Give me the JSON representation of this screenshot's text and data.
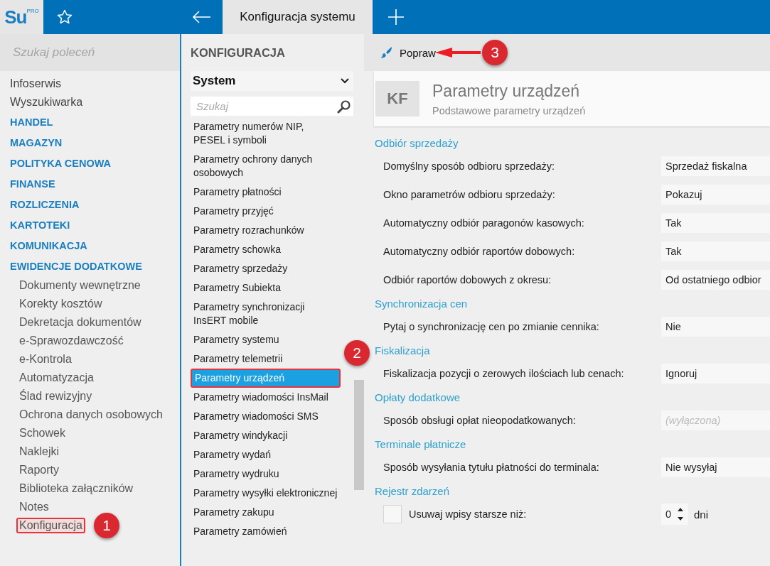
{
  "topbar": {
    "logo": {
      "text": "Su",
      "sup": "PRO"
    },
    "tab": "Konfiguracja systemu"
  },
  "sidebar": {
    "search": {
      "placeholder": "Szukaj poleceń"
    },
    "items": [
      {
        "label": "Infoserwis",
        "kind": "link",
        "highlighted": false
      },
      {
        "label": "Wyszukiwarka",
        "kind": "link",
        "highlighted": false
      },
      {
        "label": "HANDEL",
        "kind": "section",
        "highlighted": false
      },
      {
        "label": "MAGAZYN",
        "kind": "section",
        "highlighted": false
      },
      {
        "label": "POLITYKA CENOWA",
        "kind": "section",
        "highlighted": false
      },
      {
        "label": "FINANSE",
        "kind": "section",
        "highlighted": false
      },
      {
        "label": "ROZLICZENIA",
        "kind": "section",
        "highlighted": false
      },
      {
        "label": "KARTOTEKI",
        "kind": "section",
        "highlighted": false
      },
      {
        "label": "KOMUNIKACJA",
        "kind": "section",
        "highlighted": false
      },
      {
        "label": "EWIDENCJE DODATKOWE",
        "kind": "section",
        "highlighted": false
      },
      {
        "label": "Dokumenty wewnętrzne",
        "kind": "subitem",
        "highlighted": false
      },
      {
        "label": "Korekty kosztów",
        "kind": "subitem",
        "highlighted": false
      },
      {
        "label": "Dekretacja dokumentów",
        "kind": "subitem",
        "highlighted": false
      },
      {
        "label": "e-Sprawozdawczość",
        "kind": "subitem",
        "highlighted": false
      },
      {
        "label": "e-Kontrola",
        "kind": "subitem",
        "highlighted": false
      },
      {
        "label": "Automatyzacja",
        "kind": "subitem",
        "highlighted": false
      },
      {
        "label": "Ślad rewizyjny",
        "kind": "subitem",
        "highlighted": false
      },
      {
        "label": "Ochrona danych osobowych",
        "kind": "subitem",
        "highlighted": false
      },
      {
        "label": "Schowek",
        "kind": "subitem",
        "highlighted": false
      },
      {
        "label": "Naklejki",
        "kind": "subitem",
        "highlighted": false
      },
      {
        "label": "Raporty",
        "kind": "subitem",
        "highlighted": false
      },
      {
        "label": "Biblioteka załączników",
        "kind": "subitem",
        "highlighted": false
      },
      {
        "label": "Notes",
        "kind": "subitem",
        "highlighted": false
      },
      {
        "label": "Konfiguracja",
        "kind": "subitem",
        "highlighted": true
      }
    ]
  },
  "config": {
    "title": "KONFIGURACJA",
    "category": "System",
    "search": {
      "placeholder": "Szukaj"
    },
    "items": [
      {
        "label": "Parametry numerów NIP, PESEL i symboli",
        "selected": false
      },
      {
        "label": "Parametry ochrony danych osobowych",
        "selected": false
      },
      {
        "label": "Parametry płatności",
        "selected": false
      },
      {
        "label": "Parametry przyjęć",
        "selected": false
      },
      {
        "label": "Parametry rozrachunków",
        "selected": false
      },
      {
        "label": "Parametry schowka",
        "selected": false
      },
      {
        "label": "Parametry sprzedaży",
        "selected": false
      },
      {
        "label": "Parametry Subiekta",
        "selected": false
      },
      {
        "label": "Parametry synchronizacji InsERT mobile",
        "selected": false
      },
      {
        "label": "Parametry systemu",
        "selected": false
      },
      {
        "label": "Parametry telemetrii",
        "selected": false
      },
      {
        "label": "Parametry urządzeń",
        "selected": true
      },
      {
        "label": "Parametry wiadomości InsMail",
        "selected": false
      },
      {
        "label": "Parametry wiadomości SMS",
        "selected": false
      },
      {
        "label": "Parametry windykacji",
        "selected": false
      },
      {
        "label": "Parametry wydań",
        "selected": false
      },
      {
        "label": "Parametry wydruku",
        "selected": false
      },
      {
        "label": "Parametry wysyłki elektronicznej",
        "selected": false
      },
      {
        "label": "Parametry zakupu",
        "selected": false
      },
      {
        "label": "Parametry zamówień",
        "selected": false
      }
    ]
  },
  "detail": {
    "toolbar": {
      "button": "Popraw"
    },
    "header": {
      "badge": "KF",
      "title": "Parametry urządzeń",
      "subtitle": "Podstawowe parametry urządzeń"
    },
    "groups": [
      {
        "title": "Odbiór sprzedaży",
        "rows": [
          {
            "kind": "select",
            "label": "Domyślny sposób odbioru sprzedaży:",
            "value": "Sprzedaż fiskalna"
          },
          {
            "kind": "select",
            "label": "Okno parametrów odbioru sprzedaży:",
            "value": "Pokazuj"
          },
          {
            "kind": "select",
            "label": "Automatyczny odbiór paragonów kasowych:",
            "value": "Tak"
          },
          {
            "kind": "select",
            "label": "Automatyczny odbiór raportów dobowych:",
            "value": "Tak"
          },
          {
            "kind": "select",
            "label": "Odbiór raportów dobowych z okresu:",
            "value": "Od ostatniego odbior"
          }
        ]
      },
      {
        "title": "Synchronizacja cen",
        "rows": [
          {
            "kind": "select",
            "label": "Pytaj o synchronizację cen po zmianie cennika:",
            "value": "Nie"
          }
        ]
      },
      {
        "title": "Fiskalizacja",
        "rows": [
          {
            "kind": "select",
            "label": "Fiskalizacja pozycji o zerowych ilościach lub cenach:",
            "value": "Ignoruj"
          }
        ]
      },
      {
        "title": "Opłaty dodatkowe",
        "rows": [
          {
            "kind": "disabled",
            "label": "Sposób obsługi opłat nieopodatkowanych:",
            "value": "(wyłączona)"
          }
        ]
      },
      {
        "title": "Terminale płatnicze",
        "rows": [
          {
            "kind": "select",
            "label": "Sposób wysyłania tytułu płatności do terminala:",
            "value": "Nie wysyłaj"
          }
        ]
      },
      {
        "title": "Rejestr zdarzeń",
        "rows": [
          {
            "kind": "spin",
            "label": "Usuwaj wpisy starsze niż:",
            "value": "0",
            "unit": "dni",
            "checked": false
          }
        ]
      }
    ]
  },
  "annotations": [
    {
      "label": "1"
    },
    {
      "label": "2"
    },
    {
      "label": "3"
    }
  ]
}
